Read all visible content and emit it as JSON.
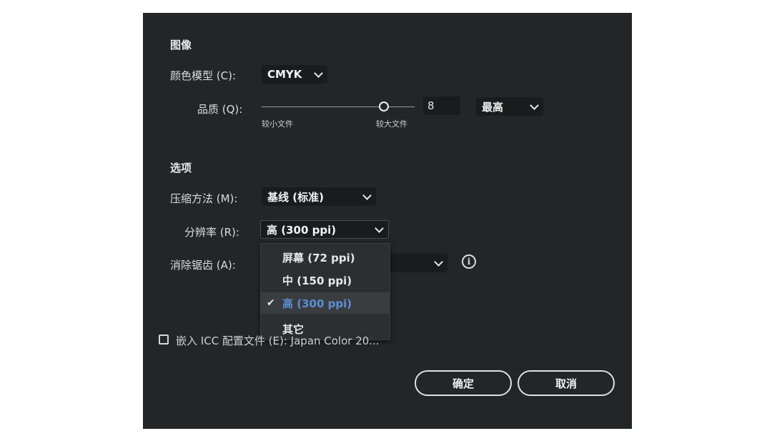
{
  "image_section": {
    "title": "图像",
    "color_model": {
      "label": "颜色模型 (C):",
      "value": "CMYK"
    },
    "quality": {
      "label": "品质 (Q):",
      "value": "8",
      "preset": "最高",
      "min_label": "较小文件",
      "max_label": "较大文件",
      "slider_fraction": 0.8
    }
  },
  "options_section": {
    "title": "选项",
    "compression": {
      "label": "压缩方法 (M):",
      "value": "基线 (标准)"
    },
    "resolution": {
      "label": "分辨率 (R):",
      "value": "高 (300 ppi)",
      "menu": [
        {
          "label": "屏幕 (72 ppi)",
          "selected": false
        },
        {
          "label": "中 (150 ppi)",
          "selected": false
        },
        {
          "label": "高 (300 ppi)",
          "selected": true
        },
        {
          "label": "其它",
          "selected": false
        }
      ]
    },
    "anti_alias": {
      "label": "消除锯齿 (A):"
    }
  },
  "embed_icc": {
    "label": "嵌入 ICC 配置文件 (E): Japan Color 20...",
    "checked": false
  },
  "buttons": {
    "ok": "确定",
    "cancel": "取消"
  },
  "icons": {
    "info": "info-icon",
    "check": "checkmark-icon",
    "dropdown": "chevron-down-icon"
  }
}
